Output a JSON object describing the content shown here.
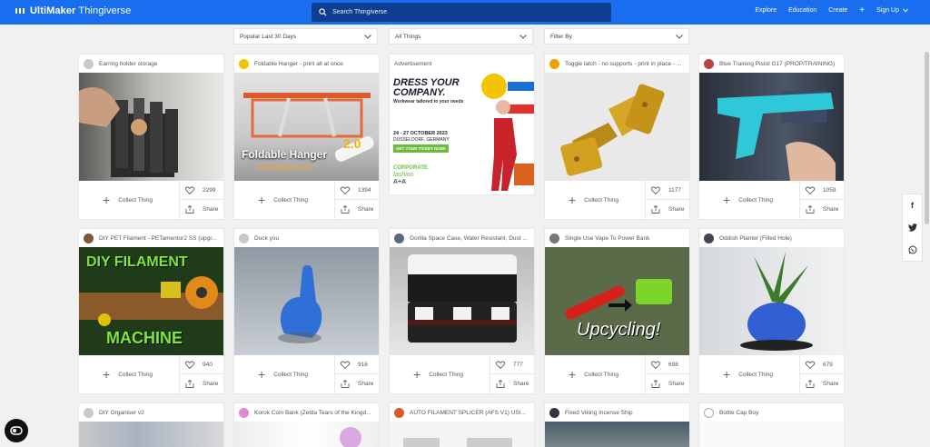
{
  "header": {
    "logo_brand": "UltiMaker",
    "logo_product": "Thingiverse",
    "search_placeholder": "Search Thingiverse",
    "nav": {
      "explore": "Explore",
      "education": "Education",
      "create": "Create",
      "signup": "Sign Up"
    }
  },
  "filters": {
    "sort": "Popular Last 30 Days",
    "category": "All Things",
    "filter_by": "Filter By"
  },
  "common": {
    "collect_label": "Collect Thing",
    "share_label": "Share"
  },
  "ad": {
    "label": "Advertisement",
    "headline": "DRESS YOUR COMPANY.",
    "subline": "Workwear tailored to your needs",
    "dates": "24 - 27 OCTOBER 2023",
    "location": "DÜSSELDORF, GERMANY",
    "cta": "GET YOUR TICKET NOW!",
    "brand_line1": "CORPORATE",
    "brand_line2": "fashion",
    "brand_line3": "A+A"
  },
  "cards": [
    {
      "title": "Earring holder storage",
      "likes": "2299"
    },
    {
      "title": "Foldable Hanger - print all at once",
      "likes": "1394",
      "img_title": "Foldable Hanger",
      "img_sub": "Print all at once",
      "img_version": "2.0"
    },
    {
      "title": "Toggle latch - no supports - print in place - ...",
      "likes": "1177"
    },
    {
      "title": "Blue Training Pistol G17 (PROP/TRAINING)",
      "likes": "1059"
    },
    {
      "title": "DIY PET Filament - PETamentor2 SS (upgr...",
      "likes": "940",
      "img_title": "DIY FILAMENT",
      "img_sub": "MACHINE"
    },
    {
      "title": "Duck you",
      "likes": "916"
    },
    {
      "title": "Gorilla Space Case, Water Resistant, Dust ...",
      "likes": "777"
    },
    {
      "title": "Single Use Vape To Power Bank",
      "likes": "698",
      "img_title": "Upcycling!"
    },
    {
      "title": "Oddish Planter (Filled Hole)",
      "likes": "679"
    },
    {
      "title": "DIY Organiser v2"
    },
    {
      "title": "Korok Coin Bank (Zelda Tears of the Kingd..."
    },
    {
      "title": "AUTO FILAMENT SPLICER (AFS V1) USI..."
    },
    {
      "title": "Fixed Viking Incense Ship"
    },
    {
      "title": "Bottle Cap Boy"
    }
  ]
}
